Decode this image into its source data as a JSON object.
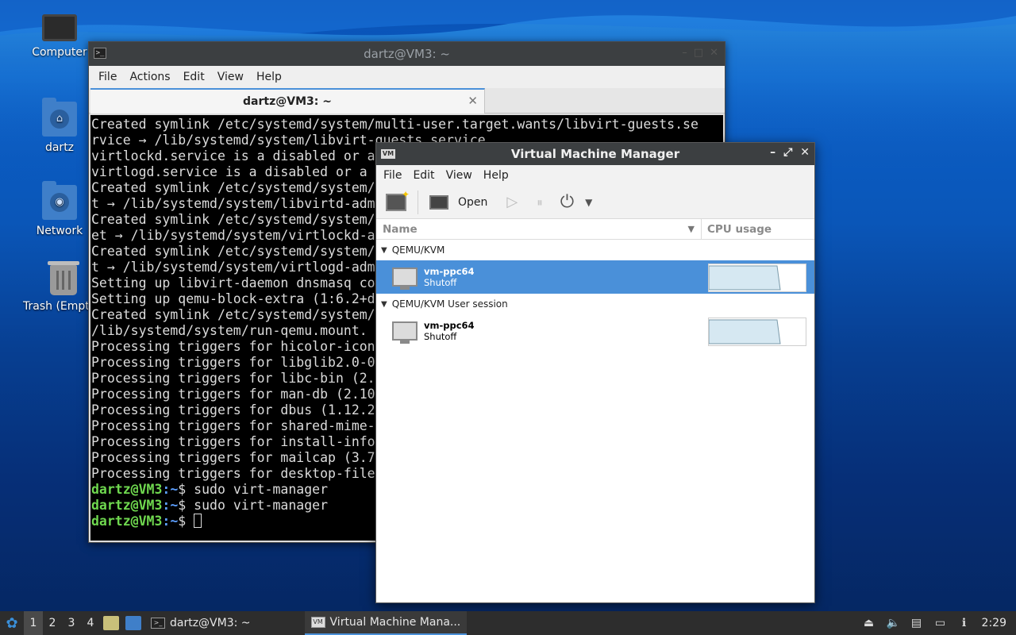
{
  "desktop": {
    "icons": [
      {
        "label": "Computer"
      },
      {
        "label": "dartz"
      },
      {
        "label": "Network"
      },
      {
        "label": "Trash (Empty)"
      }
    ]
  },
  "terminal": {
    "title": "dartz@VM3: ~",
    "menu": [
      "File",
      "Actions",
      "Edit",
      "View",
      "Help"
    ],
    "tab_label": "dartz@VM3: ~",
    "tab_close": "✕",
    "lines": [
      "Created symlink /etc/systemd/system/multi-user.target.wants/libvirt-guests.se",
      "rvice → /lib/systemd/system/libvirt-guests.service.",
      "virtlockd.service is a disabled or a",
      "virtlogd.service is a disabled or a",
      "Created symlink /etc/systemd/system/",
      "t → /lib/systemd/system/libvirtd-adm",
      "Created symlink /etc/systemd/system/",
      "et → /lib/systemd/system/virtlockd-a",
      "Created symlink /etc/systemd/system/",
      "t → /lib/systemd/system/virtlogd-adm",
      "Setting up libvirt-daemon dnsmasq co",
      "Setting up qemu-block-extra (1:6.2+d",
      "Created symlink /etc/systemd/system/",
      "/lib/systemd/system/run-qemu.mount.",
      "Processing triggers for hicolor-icon",
      "Processing triggers for libglib2.0-0",
      "Processing triggers for libc-bin (2.",
      "Processing triggers for man-db (2.10",
      "Processing triggers for dbus (1.12.2",
      "Processing triggers for shared-mime-",
      "Processing triggers for install-info",
      "Processing triggers for mailcap (3.7",
      "Processing triggers for desktop-file"
    ],
    "prompt_user": "dartz@VM3",
    "prompt_path": ":~",
    "prompt_symbol": "$ ",
    "commands": [
      "sudo virt-manager",
      "sudo virt-manager",
      ""
    ]
  },
  "vmm": {
    "title": "Virtual Machine Manager",
    "menu": [
      "File",
      "Edit",
      "View",
      "Help"
    ],
    "toolbar": {
      "open_label": "Open"
    },
    "columns": {
      "name": "Name",
      "cpu": "CPU usage"
    },
    "groups": [
      {
        "label": "QEMU/KVM",
        "vm": {
          "name": "vm-ppc64",
          "state": "Shutoff",
          "selected": true
        }
      },
      {
        "label": "QEMU/KVM User session",
        "vm": {
          "name": "vm-ppc64",
          "state": "Shutoff",
          "selected": false
        }
      }
    ]
  },
  "taskbar": {
    "workspaces": [
      "1",
      "2",
      "3",
      "4"
    ],
    "active_workspace": "1",
    "tasks": [
      {
        "label": "dartz@VM3: ~"
      },
      {
        "label": "Virtual Machine Mana..."
      }
    ],
    "clock": "2:29",
    "accent": "#4a90d9"
  }
}
